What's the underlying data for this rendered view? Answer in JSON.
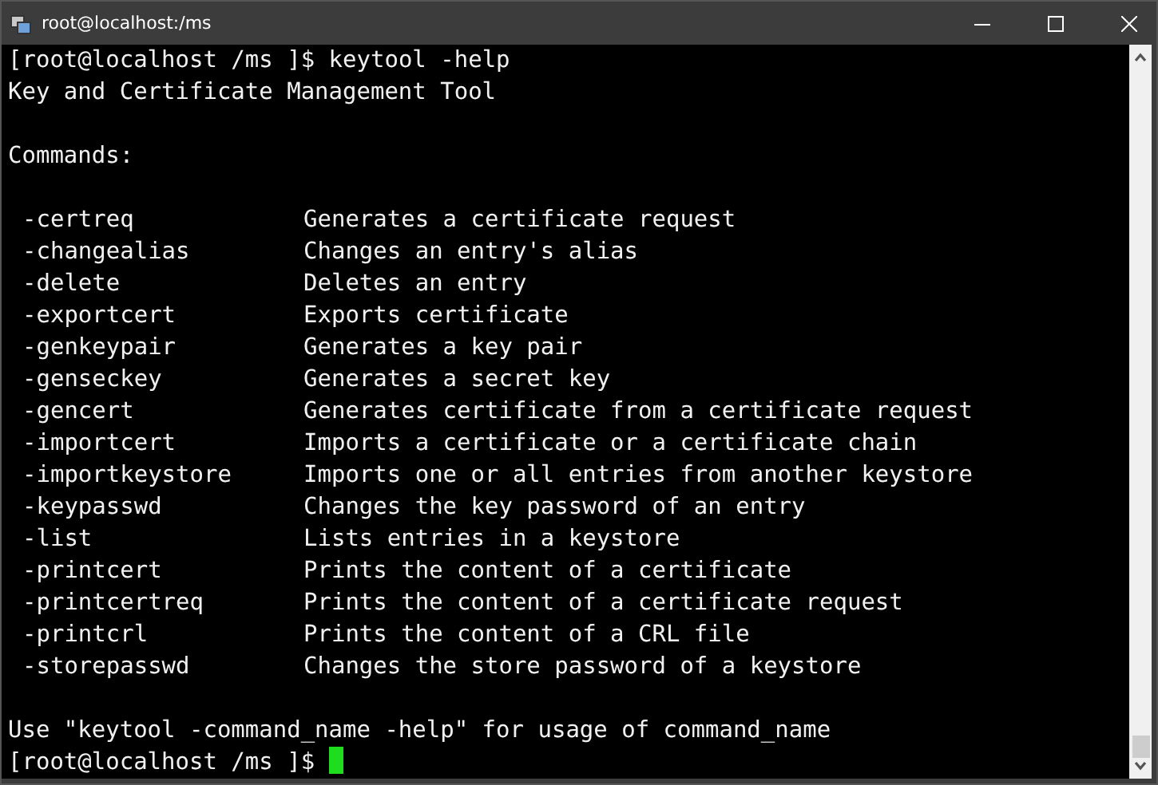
{
  "window": {
    "title": "root@localhost:/ms"
  },
  "terminal": {
    "command_line": {
      "prompt": "[root@localhost /ms ]$",
      "command": "keytool -help"
    },
    "title_line": "Key and Certificate Management Tool",
    "section_heading": "Commands:",
    "commands": [
      {
        "option": "-certreq",
        "description": "Generates a certificate request"
      },
      {
        "option": "-changealias",
        "description": "Changes an entry's alias"
      },
      {
        "option": "-delete",
        "description": "Deletes an entry"
      },
      {
        "option": "-exportcert",
        "description": "Exports certificate"
      },
      {
        "option": "-genkeypair",
        "description": "Generates a key pair"
      },
      {
        "option": "-genseckey",
        "description": "Generates a secret key"
      },
      {
        "option": "-gencert",
        "description": "Generates certificate from a certificate request"
      },
      {
        "option": "-importcert",
        "description": "Imports a certificate or a certificate chain"
      },
      {
        "option": "-importkeystore",
        "description": "Imports one or all entries from another keystore"
      },
      {
        "option": "-keypasswd",
        "description": "Changes the key password of an entry"
      },
      {
        "option": "-list",
        "description": "Lists entries in a keystore"
      },
      {
        "option": "-printcert",
        "description": "Prints the content of a certificate"
      },
      {
        "option": "-printcertreq",
        "description": "Prints the content of a certificate request"
      },
      {
        "option": "-printcrl",
        "description": "Prints the content of a CRL file"
      },
      {
        "option": "-storepasswd",
        "description": "Changes the store password of a keystore"
      }
    ],
    "usage_line": "Use \"keytool -command_name -help\" for usage of command_name",
    "prompt": "[root@localhost /ms ]$"
  }
}
